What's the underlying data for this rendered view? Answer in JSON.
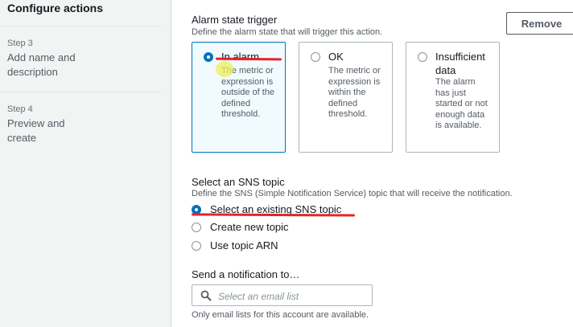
{
  "sidebar": {
    "title": "Configure actions",
    "steps": [
      {
        "step": "Step 3",
        "label": "Add name and description"
      },
      {
        "step": "Step 4",
        "label": "Preview and create"
      }
    ]
  },
  "alarm_trigger": {
    "title": "Alarm state trigger",
    "description": "Define the alarm state that will trigger this action.",
    "remove_label": "Remove",
    "options": [
      {
        "label": "In alarm",
        "description": "The metric or expression is outside of the defined threshold.",
        "selected": true
      },
      {
        "label": "OK",
        "description": "The metric or expression is within the defined threshold.",
        "selected": false
      },
      {
        "label": "Insufficient data",
        "description": "The alarm has just started or not enough data is available.",
        "selected": false
      }
    ]
  },
  "sns": {
    "title": "Select an SNS topic",
    "description": "Define the SNS (Simple Notification Service) topic that will receive the notification.",
    "options": [
      {
        "label": "Select an existing SNS topic",
        "selected": true
      },
      {
        "label": "Create new topic",
        "selected": false
      },
      {
        "label": "Use topic ARN",
        "selected": false
      }
    ]
  },
  "notify": {
    "title": "Send a notification to…",
    "placeholder": "Select an email list",
    "value": "",
    "hint": "Only email lists for this account are available."
  },
  "colors": {
    "accent": "#0073bb",
    "annotation": "#e0262b",
    "sidebar_bg": "#f2f3f3"
  }
}
